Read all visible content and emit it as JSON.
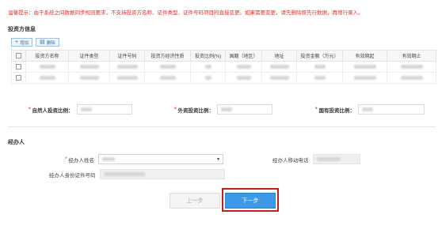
{
  "tip": "温馨提示：由于系统之间数据同步规则要求，不支持投资方名称、证件类型、证件号码项目的直接变更。如果需要变更，请先删除原先行数据，再增行录入。",
  "investor_section": {
    "title": "投资方信息",
    "add_label": "增加",
    "delete_label": "删除",
    "columns": [
      "投资方名称",
      "证件类型",
      "证件号码",
      "投资方经济性质",
      "投资比例(%)",
      "国籍（地区）",
      "地址",
      "投资金额（万元）",
      "有效期起",
      "有效期止"
    ],
    "rows": [
      {
        "cells": [
          "",
          "",
          "",
          "",
          "",
          "",
          "",
          "",
          "",
          ""
        ]
      },
      {
        "cells": [
          "",
          "",
          "",
          "",
          "",
          "",
          "",
          "",
          "",
          ""
        ]
      }
    ]
  },
  "ratios": {
    "natural_label": "自然人投资比例：",
    "foreign_label": "外资投资比例：",
    "state_label": "国有投资比例："
  },
  "agent_section": {
    "title": "经办人",
    "name_label": "经办人姓名",
    "phone_label": "经办人移动电话",
    "id_label": "经办人身份证件号码"
  },
  "buttons": {
    "prev": "上一步",
    "next": "下一步"
  }
}
